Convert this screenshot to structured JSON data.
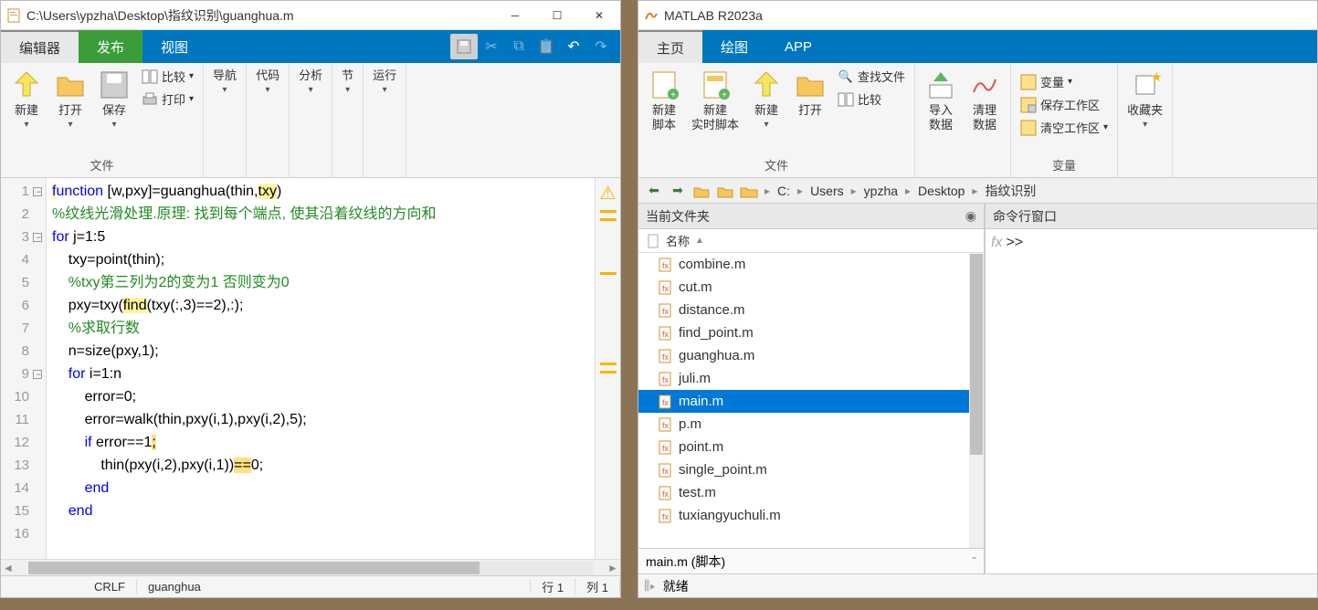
{
  "editor": {
    "title": "C:\\Users\\ypzha\\Desktop\\指纹识别\\guanghua.m",
    "tabs": {
      "t1": "编辑器",
      "t2": "发布",
      "t3": "视图"
    },
    "ribbon": {
      "new": "新建",
      "open": "打开",
      "save": "保存",
      "compare": "比较",
      "print": "打印",
      "nav": "导航",
      "code": "代码",
      "analyze": "分析",
      "section": "节",
      "run": "运行",
      "group_file": "文件"
    },
    "code_lines": [
      {
        "n": 1,
        "html": "<span class='kw hl'>f</span><span class='kw'>unction</span> [w,pxy]=guanghua(thin,<span class='hl'>txy</span>)"
      },
      {
        "n": 2,
        "html": "<span class='cm'>%纹线光滑处理.原理: 找到每个端点, 使其沿着纹线的方向和</span>"
      },
      {
        "n": 3,
        "html": "<span class='kw'>for</span> j=1:5"
      },
      {
        "n": 4,
        "html": "    txy=point(thin);"
      },
      {
        "n": 5,
        "html": "    <span class='cm'>%txy第三列为2的变为1 否则变为0</span>"
      },
      {
        "n": 6,
        "html": "    pxy=txy(<span class='hl'>find</span>(txy(:,3)==2),:);"
      },
      {
        "n": 7,
        "html": "    <span class='cm'>%求取行数</span>"
      },
      {
        "n": 8,
        "html": "    n=size(pxy,1);"
      },
      {
        "n": 9,
        "html": "    <span class='kw'>for</span> i=1:n"
      },
      {
        "n": 10,
        "html": "        error=0;"
      },
      {
        "n": 11,
        "html": "        error=walk(thin,pxy(i,1),pxy(i,2),5);"
      },
      {
        "n": 12,
        "html": "        <span class='kw'>if</span> error==1<span class='hl2'>;</span>"
      },
      {
        "n": 13,
        "html": "            thin(pxy(i,2),pxy(i,1))<span class='hl2'>==</span>0;"
      },
      {
        "n": 14,
        "html": "        <span class='kw'>end</span>"
      },
      {
        "n": 15,
        "html": "    <span class='kw'>end</span>"
      },
      {
        "n": 16,
        "html": ""
      }
    ],
    "status": {
      "eol": "CRLF",
      "func": "guanghua",
      "line_lbl": "行",
      "line": "1",
      "col_lbl": "列",
      "col": "1"
    }
  },
  "matlab": {
    "title": "MATLAB R2023a",
    "tabs": {
      "home": "主页",
      "plots": "绘图",
      "apps": "APP"
    },
    "ribbon": {
      "new_script": "新建\n脚本",
      "new_live": "新建\n实时脚本",
      "new": "新建",
      "open": "打开",
      "find_files": "查找文件",
      "compare": "比较",
      "import": "导入\n数据",
      "clean": "清理\n数据",
      "var": "变量",
      "save_ws": "保存工作区",
      "clear_ws": "清空工作区",
      "fav": "收藏夹",
      "grp_file": "文件",
      "grp_var": "变量"
    },
    "path": {
      "drive": "C:",
      "p1": "Users",
      "p2": "ypzha",
      "p3": "Desktop",
      "p4": "指纹识别"
    },
    "folder_panel": "当前文件夹",
    "col_name": "名称",
    "files": [
      {
        "name": "combine.m",
        "sel": false
      },
      {
        "name": "cut.m",
        "sel": false
      },
      {
        "name": "distance.m",
        "sel": false
      },
      {
        "name": "find_point.m",
        "sel": false
      },
      {
        "name": "guanghua.m",
        "sel": false
      },
      {
        "name": "juli.m",
        "sel": false
      },
      {
        "name": "main.m",
        "sel": true
      },
      {
        "name": "p.m",
        "sel": false
      },
      {
        "name": "point.m",
        "sel": false
      },
      {
        "name": "single_point.m",
        "sel": false
      },
      {
        "name": "test.m",
        "sel": false
      },
      {
        "name": "tuxiangyuchuli.m",
        "sel": false
      }
    ],
    "detail": "main.m (脚本)",
    "cmd_panel": "命令行窗口",
    "prompt": ">>",
    "status": "就绪"
  }
}
